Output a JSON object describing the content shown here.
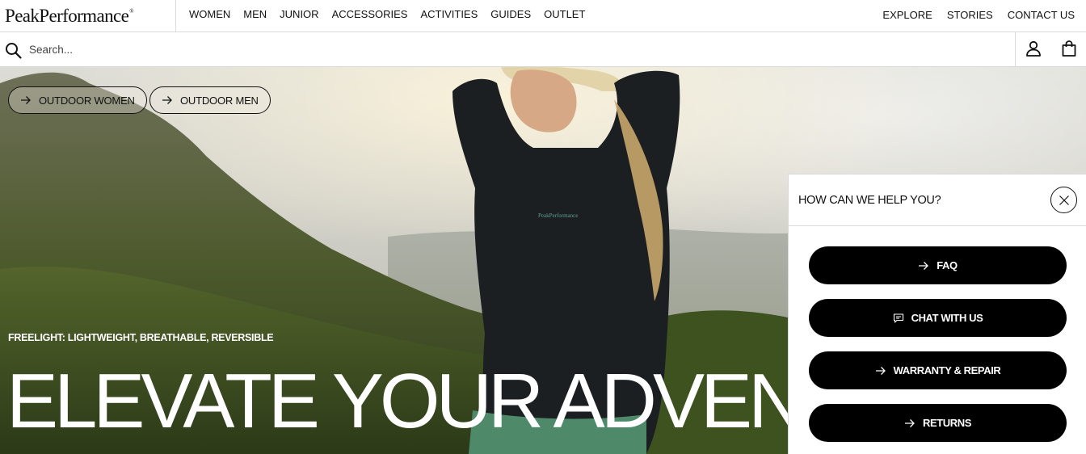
{
  "brand": {
    "logo_text": "PeakPerformance",
    "logo_mark": "®"
  },
  "nav": {
    "main": [
      "WOMEN",
      "MEN",
      "JUNIOR",
      "ACCESSORIES",
      "ACTIVITIES",
      "GUIDES",
      "OUTLET"
    ],
    "right": [
      "EXPLORE",
      "STORIES",
      "CONTACT US"
    ]
  },
  "search": {
    "placeholder": "Search...",
    "value": ""
  },
  "icons": {
    "search": "search-icon",
    "account": "account-icon",
    "bag": "shopping-bag-icon",
    "arrow": "arrow-right-icon",
    "chat": "chat-icon",
    "close": "close-icon"
  },
  "hero": {
    "pills": [
      "OUTDOOR WOMEN",
      "OUTDOOR MEN"
    ],
    "kicker": "FREELIGHT: LIGHTWEIGHT, BREATHABLE, REVERSIBLE",
    "headline": "ELEVATE YOUR ADVENT",
    "jacket_logo": "PeakPerformance"
  },
  "help": {
    "title": "HOW CAN WE HELP YOU?",
    "buttons": [
      "FAQ",
      "CHAT WITH US",
      "WARRANTY & REPAIR",
      "RETURNS"
    ]
  },
  "colors": {
    "text": "#111111",
    "panel_button": "#000000",
    "divider": "#d9d9d9",
    "hero_text": "#ffffff"
  }
}
